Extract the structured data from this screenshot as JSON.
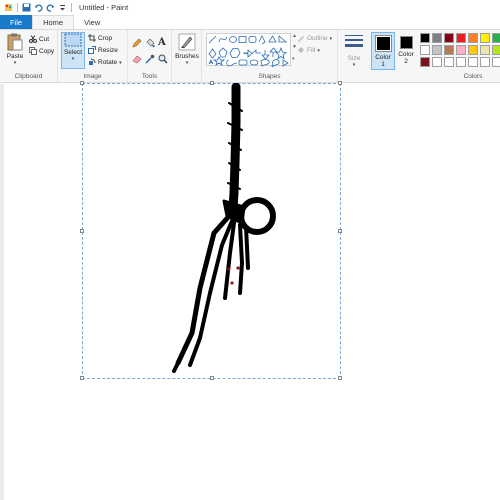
{
  "window": {
    "title": "Untitled - Paint"
  },
  "tabs": {
    "file": "File",
    "home": "Home",
    "view": "View"
  },
  "clipboard": {
    "paste": "Paste",
    "cut": "Cut",
    "copy": "Copy",
    "label": "Clipboard"
  },
  "image": {
    "select": "Select",
    "crop": "Crop",
    "resize": "Resize",
    "rotate": "Rotate",
    "label": "Image"
  },
  "tools": {
    "label": "Tools"
  },
  "brushes": {
    "label": "Brushes"
  },
  "shapes": {
    "outline": "Outline",
    "fill": "Fill",
    "label": "Shapes"
  },
  "size": {
    "label": "Size"
  },
  "color1": {
    "label": "Color",
    "num": "1",
    "value": "#000000"
  },
  "color2": {
    "label": "Color",
    "num": "2",
    "value": "#000000"
  },
  "colors": {
    "label": "Colors",
    "palette": [
      [
        "#000000",
        "#7f7f7f",
        "#880015",
        "#ed1c24",
        "#ff7f27",
        "#fff200",
        "#22b14c"
      ],
      [
        "#ffffff",
        "#c3c3c3",
        "#b97a57",
        "#ffaec9",
        "#ffc90e",
        "#efe4b0",
        "#b5e61d"
      ],
      [
        "#7a1418",
        "#ffffff",
        "#ffffff",
        "#ffffff",
        "#ffffff",
        "#ffffff",
        "#ffffff"
      ]
    ]
  }
}
